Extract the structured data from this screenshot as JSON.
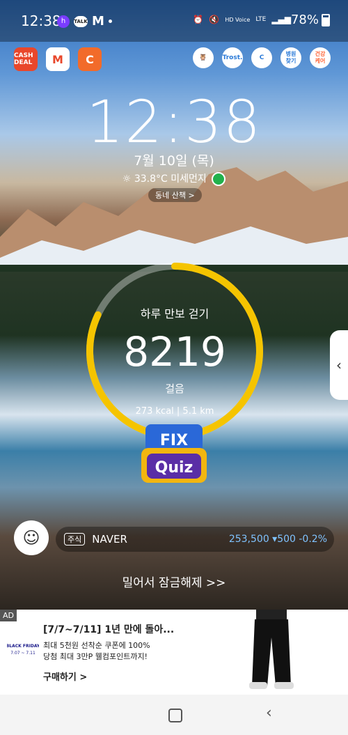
{
  "status_bar": {
    "time": "12:38",
    "talk": "TALK",
    "mail": "M",
    "volte": "HD Voice",
    "network": "LTE",
    "battery": "78%"
  },
  "shortcuts_left": [
    {
      "label": "CASH DEAL",
      "color": "#e9472b"
    },
    {
      "label": "M",
      "color": "#ffffff"
    },
    {
      "label": "C",
      "color": "#f26b2a"
    }
  ],
  "shortcuts_right": [
    {
      "label": "",
      "icon": "owl-icon"
    },
    {
      "label": "Trost.",
      "icon": "trost-icon"
    },
    {
      "label": "",
      "icon": "c-icon"
    },
    {
      "label": "병원\n찾기",
      "icon": "hospital-icon"
    },
    {
      "label": "건강\n케어",
      "icon": "health-icon"
    }
  ],
  "lock": {
    "time": "12:38",
    "date": "7월 10일 (목)",
    "weather": "33.8°C 미세먼지",
    "walk_link": "동네 산책 >"
  },
  "pedometer": {
    "title": "하루 만보 걷기",
    "steps": "8219",
    "unit": "걸음",
    "stats": "273 kcal | 5.1 km",
    "progress_fraction": 0.82,
    "accent": "#f5c400"
  },
  "quiz": {
    "top": "FIX",
    "bottom": "Quiz"
  },
  "stock": {
    "tag": "주식",
    "name": "NAVER",
    "value": "253,500 ▾500 -0.2%",
    "value_color": "#7fc3ff"
  },
  "avatar_label": "cash talk",
  "unlock_text": "밀어서 잠금해제 >>",
  "ad": {
    "badge": "AD",
    "title": "[7/7~7/11] 1년 만에 돌아...",
    "desc1": "최대 5천원 선착순 쿠폰에 100%",
    "desc2": "당첨 최대 3만P 웰컴포인트까지!",
    "cta": "구매하기 >",
    "logo_text": "BLACK FRIDAY 7.07 ~ 7.11"
  }
}
